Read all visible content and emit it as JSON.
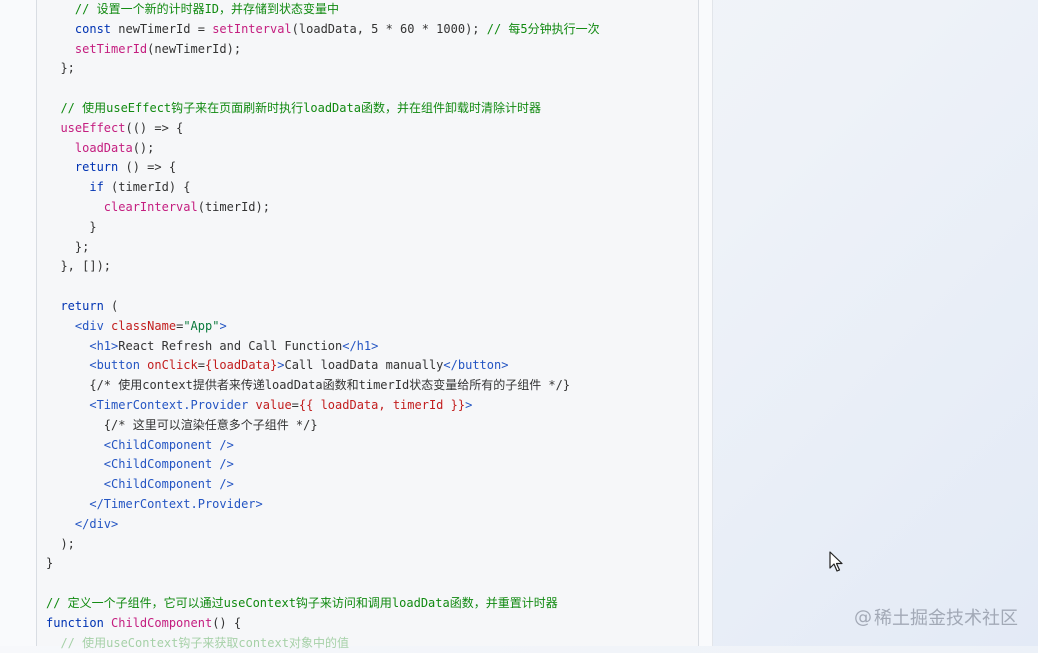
{
  "code_lines": [
    [
      {
        "t": "    "
      },
      {
        "t": "// 设置一个新的计时器ID，并存储到状态变量中",
        "c": "cm"
      }
    ],
    [
      {
        "t": "    "
      },
      {
        "t": "const",
        "c": "kw"
      },
      {
        "t": " newTimerId = "
      },
      {
        "t": "setInterval",
        "c": "fn"
      },
      {
        "t": "(loadData, 5 * 60 * 1000); "
      },
      {
        "t": "// 每5分钟执行一次",
        "c": "cm"
      }
    ],
    [
      {
        "t": "    "
      },
      {
        "t": "setTimerId",
        "c": "fn"
      },
      {
        "t": "(newTimerId);"
      }
    ],
    [
      {
        "t": "  };"
      }
    ],
    [
      {
        "t": ""
      }
    ],
    [
      {
        "t": "  "
      },
      {
        "t": "// 使用useEffect钩子来在页面刷新时执行loadData函数，并在组件卸载时清除计时器",
        "c": "cm"
      }
    ],
    [
      {
        "t": "  "
      },
      {
        "t": "useEffect",
        "c": "fn"
      },
      {
        "t": "(() => {"
      }
    ],
    [
      {
        "t": "    "
      },
      {
        "t": "loadData",
        "c": "fn"
      },
      {
        "t": "();"
      }
    ],
    [
      {
        "t": "    "
      },
      {
        "t": "return",
        "c": "kw"
      },
      {
        "t": " () => {"
      }
    ],
    [
      {
        "t": "      "
      },
      {
        "t": "if",
        "c": "kw"
      },
      {
        "t": " (timerId) {"
      }
    ],
    [
      {
        "t": "        "
      },
      {
        "t": "clearInterval",
        "c": "fn"
      },
      {
        "t": "(timerId);"
      }
    ],
    [
      {
        "t": "      }"
      }
    ],
    [
      {
        "t": "    };"
      }
    ],
    [
      {
        "t": "  }, []);"
      }
    ],
    [
      {
        "t": ""
      }
    ],
    [
      {
        "t": "  "
      },
      {
        "t": "return",
        "c": "kw"
      },
      {
        "t": " ("
      }
    ],
    [
      {
        "t": "    "
      },
      {
        "t": "<div",
        "c": "tag"
      },
      {
        "t": " "
      },
      {
        "t": "className",
        "c": "attr"
      },
      {
        "t": "="
      },
      {
        "t": "\"App\"",
        "c": "str"
      },
      {
        "t": ">",
        "c": "tag"
      }
    ],
    [
      {
        "t": "      "
      },
      {
        "t": "<h1>",
        "c": "tag"
      },
      {
        "t": "React Refresh and Call Function"
      },
      {
        "t": "</h1>",
        "c": "tag"
      }
    ],
    [
      {
        "t": "      "
      },
      {
        "t": "<button",
        "c": "tag"
      },
      {
        "t": " "
      },
      {
        "t": "onClick",
        "c": "attr"
      },
      {
        "t": "="
      },
      {
        "t": "{loadData}",
        "c": "attr"
      },
      {
        "t": ">",
        "c": "tag"
      },
      {
        "t": "Call loadData manually"
      },
      {
        "t": "</button>",
        "c": "tag"
      }
    ],
    [
      {
        "t": "      {/* 使用context提供者来传递loadData函数和timerId状态变量给所有的子组件 */}"
      }
    ],
    [
      {
        "t": "      "
      },
      {
        "t": "<TimerContext.Provider",
        "c": "tag"
      },
      {
        "t": " "
      },
      {
        "t": "value",
        "c": "attr"
      },
      {
        "t": "="
      },
      {
        "t": "{{ loadData, timerId }}",
        "c": "attr"
      },
      {
        "t": ">",
        "c": "tag"
      }
    ],
    [
      {
        "t": "        {/* 这里可以渲染任意多个子组件 */}"
      }
    ],
    [
      {
        "t": "        "
      },
      {
        "t": "<ChildComponent />",
        "c": "tag"
      }
    ],
    [
      {
        "t": "        "
      },
      {
        "t": "<ChildComponent />",
        "c": "tag"
      }
    ],
    [
      {
        "t": "        "
      },
      {
        "t": "<ChildComponent />",
        "c": "tag"
      }
    ],
    [
      {
        "t": "      "
      },
      {
        "t": "</TimerContext.Provider>",
        "c": "tag"
      }
    ],
    [
      {
        "t": "    "
      },
      {
        "t": "</div>",
        "c": "tag"
      }
    ],
    [
      {
        "t": "  );"
      }
    ],
    [
      {
        "t": "}"
      }
    ],
    [
      {
        "t": ""
      }
    ],
    [
      {
        "t": "// 定义一个子组件，它可以通过useContext钩子来访问和调用loadData函数，并重置计时器",
        "c": "cm"
      }
    ],
    [
      {
        "t": "function",
        "c": "kw"
      },
      {
        "t": " "
      },
      {
        "t": "ChildComponent",
        "c": "fn"
      },
      {
        "t": "() {"
      }
    ],
    [
      {
        "t": "  "
      },
      {
        "t": "// 使用useContext钩子来获取context对象中的值",
        "c": "cm"
      }
    ]
  ],
  "watermark": {
    "at": "@",
    "text": "稀土掘金技术社区"
  },
  "colors": {
    "keyword": "#0033b3",
    "function": "#c41d7f",
    "comment": "#118a11",
    "tag": "#2455c3",
    "attribute": "#c21d1d",
    "string": "#0a7a3c"
  }
}
